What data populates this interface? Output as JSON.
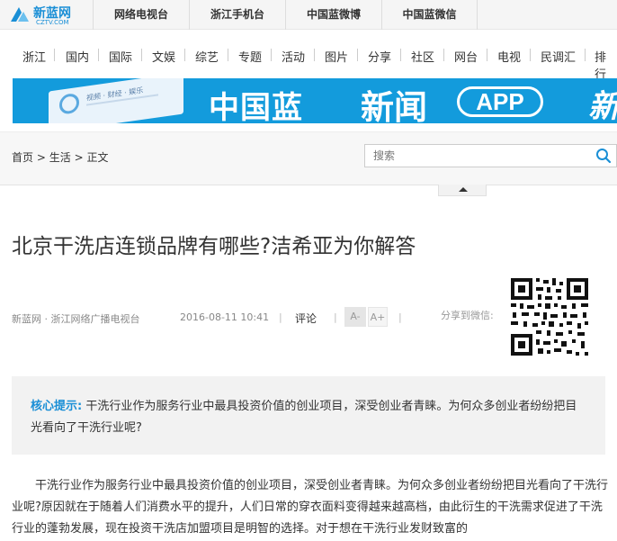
{
  "site": {
    "logo_name": "新蓝网",
    "logo_sub": "CZTV.COM"
  },
  "top_links": [
    "网络电视台",
    "浙江手机台",
    "中国蓝微博",
    "中国蓝微信"
  ],
  "nav": [
    "浙江",
    "国内",
    "国际",
    "文娱",
    "综艺",
    "专题",
    "活动",
    "图片",
    "分享",
    "社区",
    "网台",
    "电视",
    "民调汇",
    "排行"
  ],
  "banner": {
    "text1": "中国蓝",
    "text2": "新闻",
    "app": "APP",
    "text3": "新",
    "phone_line": "视频 · 财经 · 娱乐"
  },
  "breadcrumb": {
    "home": "首页",
    "sep": ">",
    "category": "生活",
    "current": "正文"
  },
  "search": {
    "placeholder": "搜索"
  },
  "article": {
    "title": "北京干洗店连锁品牌有哪些?洁希亚为你解答",
    "source": "新蓝网 · 浙江网络广播电视台",
    "date": "2016-08-11 10:41",
    "pipe": "|",
    "comment": "评论",
    "font_minus": "A-",
    "font_plus": "A+",
    "share_label": "分享到微信:",
    "summary_label": "核心提示:",
    "summary_text": "干洗行业作为服务行业中最具投资价值的创业项目，深受创业者青睐。为何众多创业者纷纷把目光看向了干洗行业呢?",
    "body": "干洗行业作为服务行业中最具投资价值的创业项目，深受创业者青睐。为何众多创业者纷纷把目光看向了干洗行业呢?原因就在于随着人们消费水平的提升，人们日常的穿衣面料变得越来越高档，由此衍生的干洗需求促进了干洗行业的蓬勃发展，现在投资干洗店加盟项目是明智的选择。对于想在干洗行业发财致富的"
  },
  "colors": {
    "accent": "#1a8fd6",
    "banner_bg": "#139bdc"
  }
}
